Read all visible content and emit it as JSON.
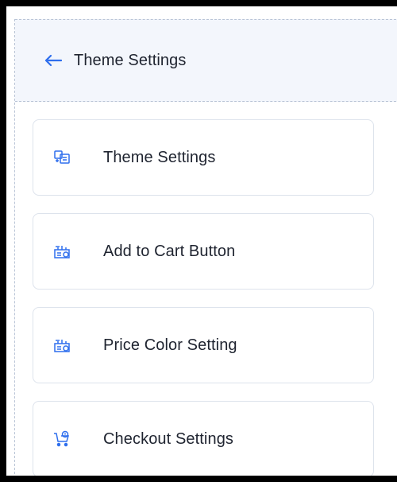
{
  "header": {
    "back_icon": "arrow-left-icon",
    "title": "Theme Settings"
  },
  "colors": {
    "accent": "#2f6fed",
    "text": "#1f2430",
    "header_bg": "#f3f6fc",
    "card_border": "#dde3ec"
  },
  "menu": {
    "items": [
      {
        "label": "Theme Settings",
        "icon": "theme-settings-icon"
      },
      {
        "label": "Add to Cart Button",
        "icon": "cart-button-icon"
      },
      {
        "label": "Price Color Setting",
        "icon": "price-color-icon"
      },
      {
        "label": "Checkout Settings",
        "icon": "checkout-cart-icon"
      }
    ]
  }
}
